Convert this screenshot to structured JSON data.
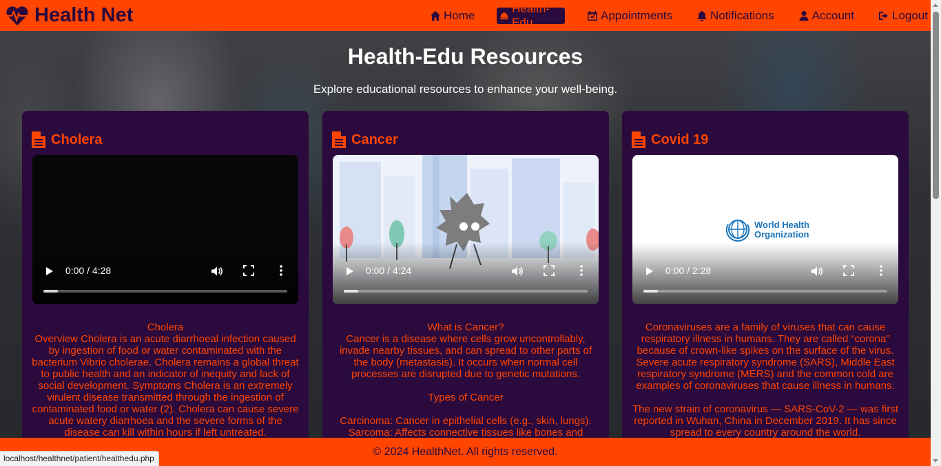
{
  "brand": {
    "name": "Health Net",
    "icon": "heartbeat-icon"
  },
  "nav": [
    {
      "label": "Home",
      "icon": "home-icon",
      "active": false
    },
    {
      "label": "Health-Edu",
      "icon": "bell-concierge-icon",
      "active": true
    },
    {
      "label": "Appointments",
      "icon": "calendar-check-icon",
      "active": false
    },
    {
      "label": "Notifications",
      "icon": "bell-icon",
      "active": false
    },
    {
      "label": "Account",
      "icon": "user-icon",
      "active": false
    },
    {
      "label": "Logout",
      "icon": "logout-icon",
      "active": false
    }
  ],
  "hero": {
    "title": "Health-Edu Resources",
    "subtitle": "Explore educational resources to enhance your well-being."
  },
  "cards": [
    {
      "title": "Cholera",
      "icon": "file-icon",
      "video": {
        "time": "0:00 / 4:28",
        "progress": 0.06
      },
      "text": "Cholera\nOverview Cholera is an acute diarrhoeal infection caused by ingestion of food or water contaminated with the bacterium Vibrio cholerae. Cholera remains a global threat to public health and an indicator of inequity and lack of social development. Symptoms Cholera is an extremely virulent disease transmitted through the ingestion of contaminated food or water (2). Cholera can cause severe acute watery diarrhoea and the severe forms of the disease can kill within hours if left untreated."
    },
    {
      "title": "Cancer",
      "icon": "file-icon",
      "video": {
        "time": "0:00 / 4:24",
        "progress": 0.06
      },
      "text": "What is Cancer?\nCancer is a disease where cells grow uncontrollably, invade nearby tissues, and can spread to other parts of the body (metastasis). It occurs when normal cell processes are disrupted due to genetic mutations.\n\nTypes of Cancer\n\nCarcinoma: Cancer in epithelial cells (e.g., skin, lungs).\nSarcoma: Affects connective tissues like bones and"
    },
    {
      "title": "Covid 19",
      "icon": "file-icon",
      "video": {
        "time": "0:00 / 2:28",
        "progress": 0.06,
        "poster_text": [
          "World Health",
          "Organization"
        ]
      },
      "text": "Coronaviruses are a family of viruses that can cause respiratory illness in humans. They are called “corona” because of crown-like spikes on the surface of the virus. Severe acute respiratory syndrome (SARS), Middle East respiratory syndrome (MERS) and the common cold are examples of coronaviruses that cause illness in humans.\n\nThe new strain of coronavirus — SARS-CoV-2 — was first reported in Wuhan, China in December 2019. It has since spread to every country around the world."
    }
  ],
  "footer": {
    "text": "© 2024 HealthNet. All rights reserved."
  },
  "status_bar": {
    "url": "localhost/healthnet/patient/healthedu.php"
  },
  "colors": {
    "primary": "#ff4500",
    "dark": "#2b0a3d",
    "text_light": "#ffffff"
  }
}
